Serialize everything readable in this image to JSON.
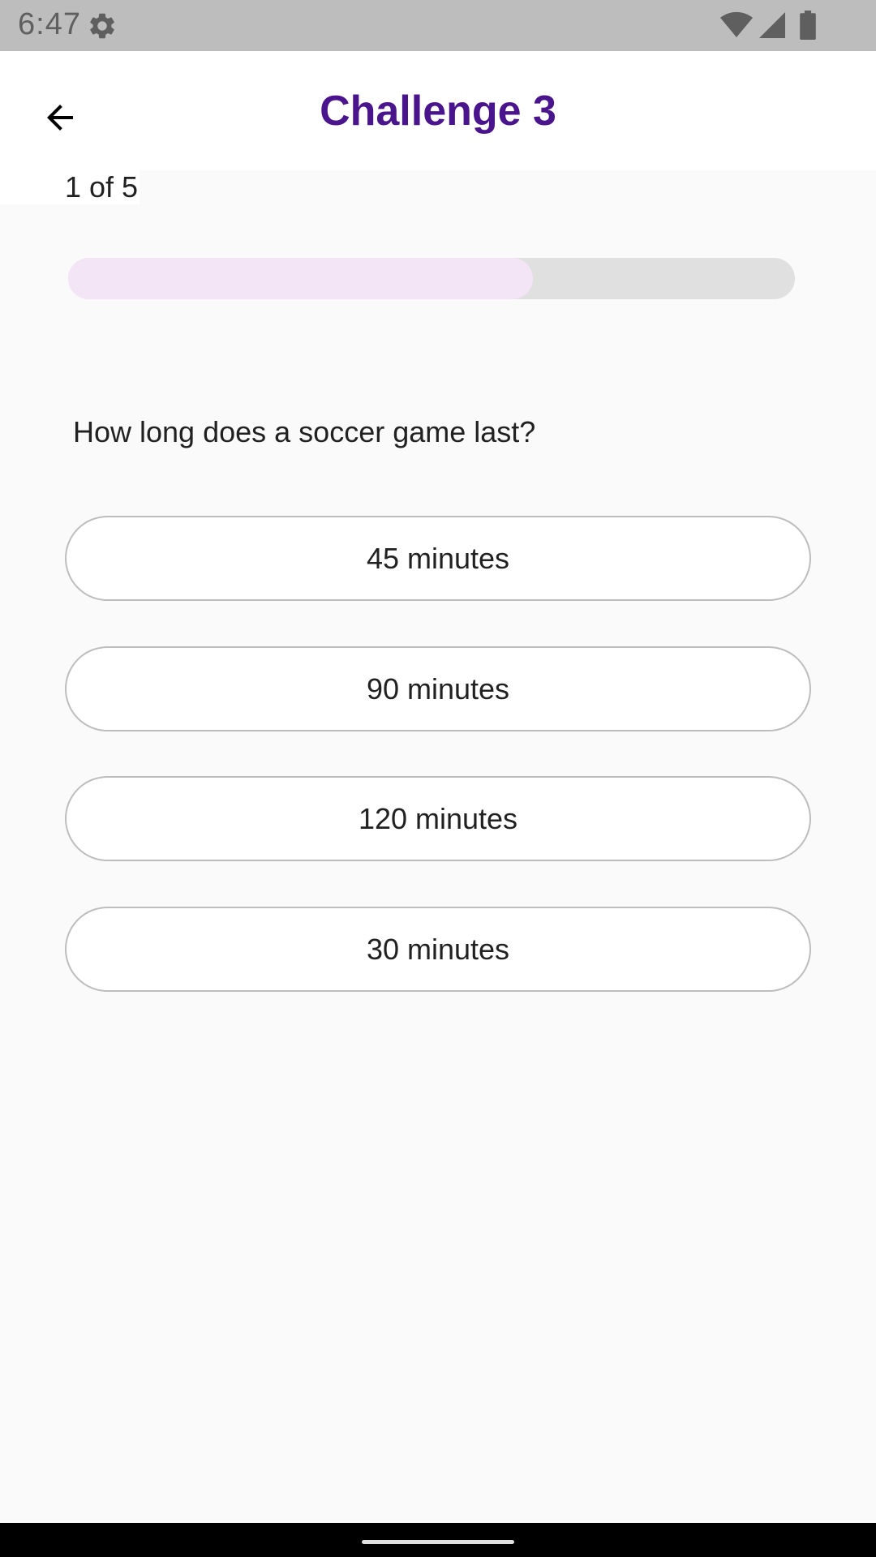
{
  "status_bar": {
    "time": "6:47",
    "icons": [
      "gear-icon",
      "wifi-icon",
      "signal-icon",
      "battery-icon"
    ]
  },
  "app_bar": {
    "title": "Challenge 3",
    "back_icon": "arrow-back-icon",
    "title_color": "#4a148c"
  },
  "quiz": {
    "counter": "1 of 5",
    "progress": 0.64,
    "question": "How long does a soccer game last?",
    "answers": [
      "45 minutes",
      "90 minutes",
      "120 minutes",
      "30 minutes"
    ]
  },
  "colors": {
    "progress_fill": "#f3e5f5",
    "progress_track": "#e0e0e0",
    "answer_border": "#bdbdbd"
  }
}
